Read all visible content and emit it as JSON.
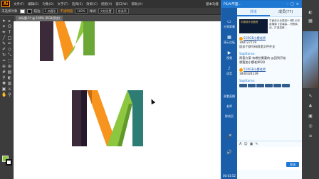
{
  "app": {
    "logo": "Ai",
    "menu": [
      "文件(F)",
      "编辑(E)",
      "对象(O)",
      "文字(T)",
      "选择(S)",
      "效果(C)",
      "视图(V)",
      "窗口(W)",
      "帮助(H)"
    ],
    "workspace_label": "基本功能"
  },
  "options_bar": {
    "selection_label": "未选择对象",
    "stroke_label": "描边",
    "stroke_value": "3 点圆形",
    "opacity_label": "不透明度",
    "opacity_value": "100%",
    "style_label": "样式",
    "doc_settings": "文档设置",
    "prefs": "首选项"
  },
  "document": {
    "tab_label": "未标题-1* @ 100% (RGB/预览)"
  },
  "toolbar": {
    "tools": [
      "selection-tool-icon",
      "direct-selection-tool-icon",
      "magic-wand-tool-icon",
      "lasso-tool-icon",
      "pen-tool-icon",
      "type-tool-icon",
      "line-tool-icon",
      "rectangle-tool-icon",
      "paintbrush-tool-icon",
      "pencil-tool-icon",
      "blob-brush-tool-icon",
      "eraser-tool-icon",
      "rotate-tool-icon",
      "scale-tool-icon",
      "width-tool-icon",
      "free-transform-tool-icon",
      "shape-builder-tool-icon",
      "perspective-grid-tool-icon",
      "mesh-tool-icon",
      "gradient-tool-icon",
      "eyedropper-tool-icon",
      "blend-tool-icon",
      "symbol-sprayer-tool-icon",
      "column-graph-tool-icon",
      "artboard-tool-icon",
      "slice-tool-icon",
      "hand-tool-icon",
      "zoom-tool-icon"
    ],
    "fill_color": "#8dc63f",
    "stroke_color": "#111111"
  },
  "artwork": {
    "colors": {
      "dark_left": "#3b2a3a",
      "dark_shade": "#24182a",
      "orange": "#f7941d",
      "orange_shade": "#c96d12",
      "green": "#8dc63f",
      "green_shade": "#5f9a2a",
      "teal": "#2e7d74"
    }
  },
  "chat": {
    "window_title": "PS/AI平面...",
    "tabs": [
      "讨论",
      "成员(77)"
    ],
    "banner": {
      "image_text": "平面设计全能班",
      "text": "平面设计全能班4.6期 计划直播课【逆袭高... 短期实战，打造高薪..."
    },
    "sidebar": [
      "分享屏幕",
      "演示白板",
      "视频",
      "语音",
      "观看直播",
      "老师",
      "群成员"
    ],
    "timer": "00:03:52",
    "messages": [
      {
        "sender": "Sagittarius",
        "lines": [
          "51RGB小樱老师",
          "108727719",
          "加这个群号码群里文件齐全"
        ]
      },
      {
        "sender": "Sagittarius",
        "lines": [
          "两套方案  有哪些需要的  @回到开始",
          "想要加小樱老师QQ"
        ]
      },
      {
        "sender": "",
        "lines": [
          "51RGB小樱老师",
          "1840324239"
        ]
      },
      {
        "sender": "Sagittarius",
        "lines": []
      }
    ],
    "send_label": "发送"
  },
  "panels": {
    "buttons": [
      "color-panel-icon",
      "color-guide-icon",
      "swatches-icon",
      "brushes-icon",
      "symbols-icon",
      "graphic-styles-icon",
      "appearance-icon",
      "layers-icon"
    ]
  }
}
